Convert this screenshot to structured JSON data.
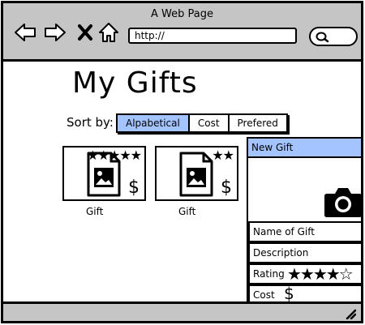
{
  "window": {
    "title": "A Web Page"
  },
  "browser": {
    "url": "http://",
    "icons": [
      "back-arrow-icon",
      "forward-arrow-icon",
      "close-icon",
      "home-icon",
      "search-icon"
    ]
  },
  "page": {
    "title": "My Gifts",
    "sort": {
      "label": "Sort by:",
      "options": [
        "Alpabetical",
        "Cost",
        "Prefered"
      ],
      "selected": "Alpabetical"
    },
    "gifts": [
      {
        "label": "Gift",
        "stars": "★★★★★",
        "rating": 5,
        "price_symbol": "$"
      },
      {
        "label": "Gift",
        "stars": "★★",
        "rating": 2,
        "price_symbol": "$"
      }
    ],
    "new_gift_panel": {
      "header": "New Gift",
      "fields": {
        "name": "Name of Gift",
        "description": "Description",
        "rating_label": "Rating",
        "rating_stars": "★★★★☆",
        "rating": 4.5,
        "cost_label": "Cost",
        "cost_symbol": "$"
      }
    }
  },
  "colors": {
    "chrome": "#c5c5c5",
    "accent": "#a3c4ff"
  }
}
